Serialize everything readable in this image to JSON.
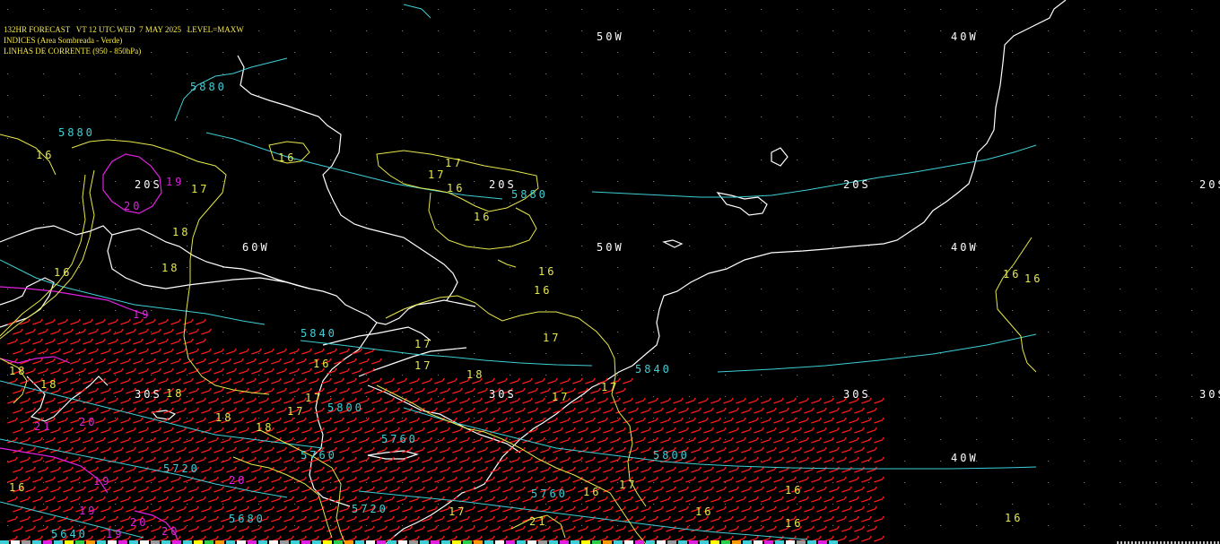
{
  "header": {
    "line1": "132HR FORECAST   VT 12 UTC WED  7 MAY 2025   LEVEL=MAXW",
    "line2": "INDICES (Area Sombreada - Verde)",
    "line3": "LINHAS DE CORRENTE (950 - 850hPa)"
  },
  "colors": {
    "background": "#000000",
    "coastline": "#ffffff",
    "geopotential": "#3ecfd6",
    "index_contour": "#e6e84a",
    "index_high": "#e020e0",
    "wind_barbs": "#ff1a1a",
    "header_text": "#f4e84a"
  },
  "grid_labels": {
    "lon": [
      "60W",
      "50W",
      "40W",
      "50W",
      "40W",
      "40W"
    ],
    "lat": [
      "20S",
      "20S",
      "20S",
      "20S",
      "30S",
      "30S",
      "30S",
      "30S"
    ]
  },
  "geopotential_labels": [
    "5880",
    "5880",
    "5880",
    "5840",
    "5840",
    "5800",
    "5800",
    "5760",
    "5760",
    "5760",
    "5720",
    "5720",
    "5680",
    "5640"
  ],
  "index_labels": [
    "17",
    "16",
    "16",
    "17",
    "17",
    "16",
    "16",
    "16",
    "16",
    "16",
    "16",
    "18",
    "18",
    "17",
    "17",
    "17",
    "18",
    "18",
    "18",
    "18",
    "17",
    "17",
    "17",
    "17",
    "17",
    "16",
    "16",
    "16",
    "16",
    "16",
    "17",
    "16",
    "16",
    "21",
    "16",
    "18",
    "18"
  ],
  "magenta_labels": [
    "19",
    "20",
    "19",
    "20",
    "19",
    "19",
    "20",
    "21",
    "20",
    "20",
    "19"
  ]
}
